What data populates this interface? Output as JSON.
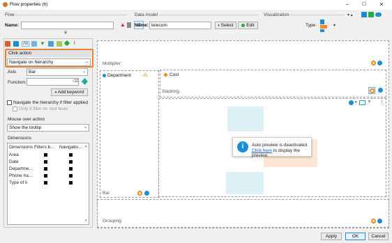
{
  "window": {
    "title": "Flow properties (tt)",
    "minimize": "−",
    "maximize": "☐",
    "close": "✕"
  },
  "flow": {
    "section_label": "Flow",
    "name_label": "Name:",
    "name_value": "",
    "expand_glyph": "¥"
  },
  "data_model": {
    "section_label": "Data model",
    "name_label": "Name:",
    "name_value": "telecom",
    "select_label": "Select",
    "edit_label": "Edit"
  },
  "visualization": {
    "section_label": "Visualization",
    "type_label": "Type:"
  },
  "left_panel": {
    "click_action_header": "Click action",
    "click_action_value": "Navigate on hierarchy",
    "axis_label": "Axis",
    "axis_value": "Bar",
    "function_label": "Function:",
    "function_value": "",
    "add_keyword_label": "Add keyword",
    "navigate_if_filter_label": "Navigate the hierarchy if filter applied",
    "only_root_label": "Only if filter on root level",
    "mouse_over_header": "Mouse over action",
    "mouse_over_value": "Show the tooltip",
    "dimensions_header": "Dimensions",
    "dimensions_columns": [
      "Dimensions",
      "Filters b...",
      "Navigatio..."
    ],
    "dimensions_rows": [
      {
        "name": "Area",
        "filter": true,
        "navigation": true
      },
      {
        "name": "Date",
        "filter": true,
        "navigation": true
      },
      {
        "name": "Departme...",
        "filter": true,
        "navigation": true
      },
      {
        "name": "Phone ha...",
        "filter": true,
        "navigation": true
      },
      {
        "name": "Type of li",
        "filter": true,
        "navigation": true
      }
    ]
  },
  "canvas": {
    "multiplier_label": "Multiplier",
    "department_label": "Department",
    "cost_label": "Cost",
    "stacking_label": "Stacking",
    "bar_label": "Bar",
    "grouping_label": "Grouping",
    "preview_message": "Auto preview is deactivated.",
    "preview_link": "Click here",
    "preview_link_suffix": " to display the preview."
  },
  "footer": {
    "apply_label": "Apply",
    "ok_label": "OK",
    "cancel_label": "Cancel"
  },
  "colors": {
    "accent_blue": "#1e8cd2",
    "orange": "#f08a24",
    "highlight_border": "#e8823a",
    "green": "#2aa84a",
    "red": "#d62b2b"
  }
}
